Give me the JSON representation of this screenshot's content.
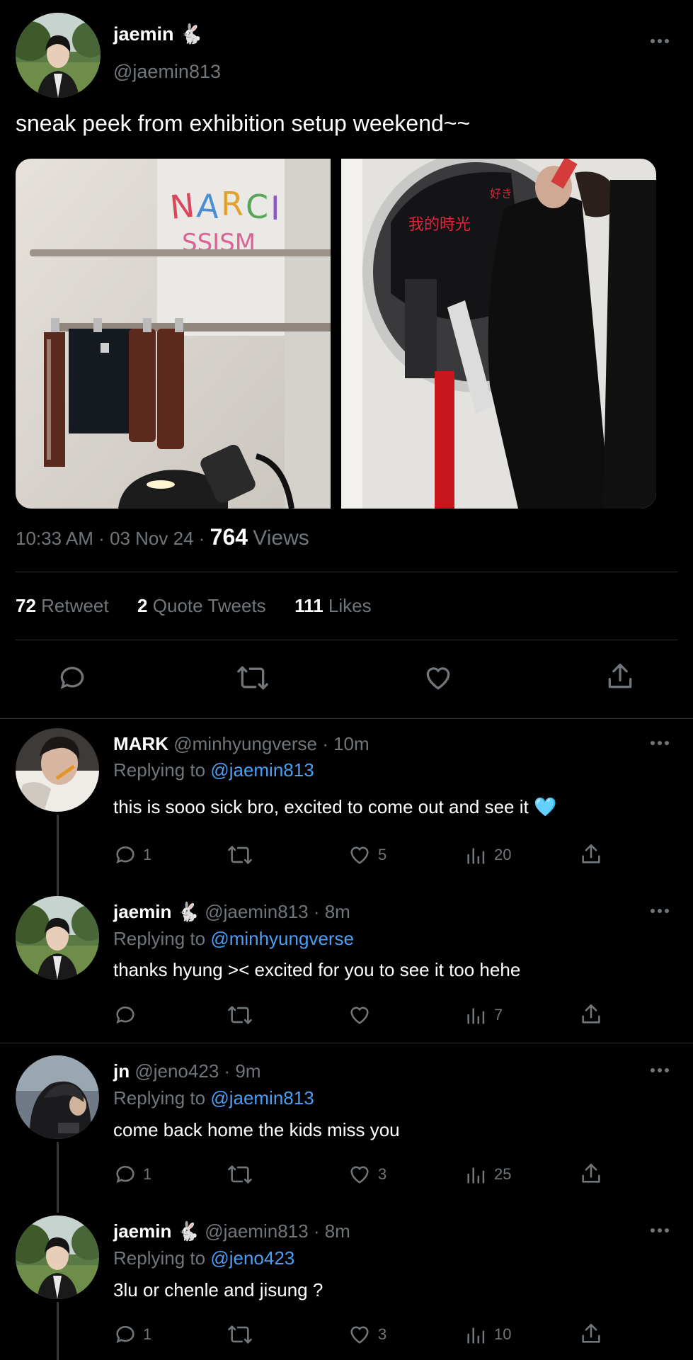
{
  "main_tweet": {
    "display_name": "jaemin",
    "name_emoji": "🐇",
    "handle": "@jaemin813",
    "text": "sneak peek from exhibition setup weekend~~",
    "images": [
      "exhibition-photo-narcissism-wall",
      "exhibition-photo-mirror"
    ],
    "time": "10:33 AM",
    "sep1": "·",
    "date": "03 Nov 24",
    "sep2": "·",
    "views_count": "764",
    "views_label": "Views",
    "stats": {
      "retweets_count": "72",
      "retweets_label": "Retweet",
      "quotes_count": "2",
      "quotes_label": "Quote Tweets",
      "likes_count": "111",
      "likes_label": "Likes"
    },
    "image1_text": "NARCI SSISM"
  },
  "replies": [
    {
      "display_name": "MARK",
      "emoji": "",
      "handle": "@minhyungverse",
      "time": "· 10m",
      "replying_label": "Replying to",
      "replying_to": "@jaemin813",
      "text": "this is sooo sick bro, excited to come out and see it 🩵",
      "reply_count": "1",
      "retweet_count": "",
      "like_count": "5",
      "views_count": "20"
    },
    {
      "display_name": "jaemin",
      "emoji": "🐇",
      "handle": "@jaemin813",
      "time": "· 8m",
      "replying_label": "Replying to",
      "replying_to": "@minhyungverse",
      "text": "thanks hyung >< excited for you to see it too hehe",
      "reply_count": "",
      "retweet_count": "",
      "like_count": "",
      "views_count": "7"
    },
    {
      "display_name": "jn",
      "emoji": "",
      "handle": "@jeno423",
      "time": "· 9m",
      "replying_label": "Replying to",
      "replying_to": "@jaemin813",
      "text": "come back home the kids miss you",
      "reply_count": "1",
      "retweet_count": "",
      "like_count": "3",
      "views_count": "25"
    },
    {
      "display_name": "jaemin",
      "emoji": "🐇",
      "handle": "@jaemin813",
      "time": "· 8m",
      "replying_label": "Replying to",
      "replying_to": "@jeno423",
      "text": "3lu or chenle and jisung ?",
      "reply_count": "1",
      "retweet_count": "",
      "like_count": "3",
      "views_count": "10"
    }
  ],
  "icons": {
    "reply": "reply-icon",
    "retweet": "retweet-icon",
    "like": "heart-icon",
    "views": "views-icon",
    "share": "share-icon",
    "more": "more-icon"
  },
  "colors": {
    "background": "#000000",
    "muted": "#71767b",
    "link": "#4b9ff5",
    "divider": "#2f3336"
  }
}
